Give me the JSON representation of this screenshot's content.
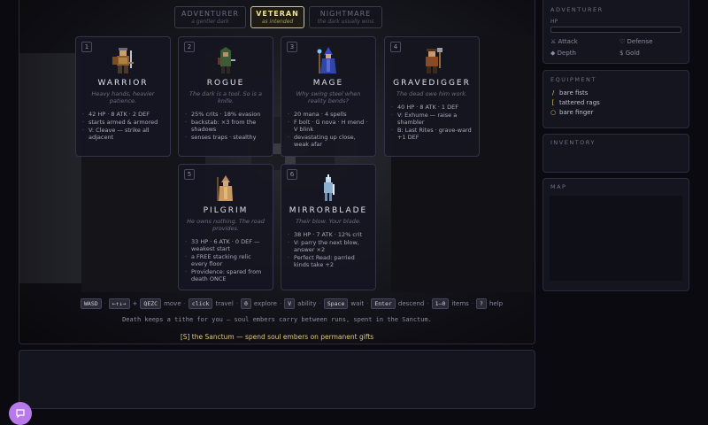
{
  "difficulty": [
    {
      "name": "ADVENTURER",
      "sub": "a gentler dark"
    },
    {
      "name": "VETERAN",
      "sub": "as intended"
    },
    {
      "name": "NIGHTMARE",
      "sub": "the dark usually wins"
    }
  ],
  "classes": [
    {
      "num": "1",
      "name": "WARRIOR",
      "tag": "Heavy hands, heavier patience.",
      "sprite": "warrior-sprite",
      "lines": [
        "42 HP · 8 ATK · 2 DEF",
        "starts armed & armored",
        "V: Cleave — strike all adjacent"
      ]
    },
    {
      "num": "2",
      "name": "ROGUE",
      "tag": "The dark is a tool. So is a knife.",
      "sprite": "rogue-sprite",
      "lines": [
        "25% crits · 18% evasion",
        "backstab: ×3 from the shadows",
        "senses traps · stealthy"
      ]
    },
    {
      "num": "3",
      "name": "MAGE",
      "tag": "Why swing steel when reality bends?",
      "sprite": "mage-sprite",
      "lines": [
        "20 mana · 4 spells",
        "F bolt · G nova · H mend · V blink",
        "devastating up close, weak afar"
      ]
    },
    {
      "num": "4",
      "name": "GRAVEDIGGER",
      "tag": "The dead owe him work.",
      "sprite": "gravedigger-sprite",
      "lines": [
        "40 HP · 8 ATK · 1 DEF",
        "V: Exhume — raise a shambler",
        "B: Last Rites · grave-ward +1 DEF"
      ]
    },
    {
      "num": "5",
      "name": "PILGRIM",
      "tag": "He owns nothing. The road provides.",
      "sprite": "pilgrim-sprite",
      "lines": [
        "33 HP · 6 ATK · 0 DEF — weakest start",
        "a FREE stacking relic every floor",
        "Providence: spared from death ONCE"
      ]
    },
    {
      "num": "6",
      "name": "MIRRORBLADE",
      "tag": "Their blow. Your blade.",
      "sprite": "mirrorblade-sprite",
      "lines": [
        "38 HP · 7 ATK · 12% crit",
        "V: parry the next blow, answer ×2",
        "Perfect Read: parried kinds take +2"
      ]
    }
  ],
  "hotkeys": {
    "k1": "WASD",
    "k2": "←↑↓→",
    "plus": "+",
    "k3": "QEZC",
    "t1": "move",
    "k4": "click",
    "t2": "travel",
    "k5": "0",
    "t3": "explore",
    "k6": "V",
    "t4": "ability",
    "k7": "Space",
    "t5": "wait",
    "k8": "Enter",
    "t6": "descend",
    "k9": "1–0",
    "t7": "items",
    "k10": "?",
    "t8": "help",
    "dot": "·"
  },
  "tithe": "Death keeps a tithe for you — soul embers carry between runs, spent in the Sanctum.",
  "sanctum": "[S] the Sanctum — spend soul embers on permanent gifts",
  "sidebar": {
    "adventurer_title": "ADVENTURER",
    "hp_label": "HP",
    "attack": "Attack",
    "defense": "Defense",
    "depth": "Depth",
    "gold": "Gold",
    "equipment_title": "EQUIPMENT",
    "equipment": [
      "bare fists",
      "tattered rags",
      "bare finger"
    ],
    "equipment_icons": [
      "/",
      "[",
      "○"
    ],
    "inventory_title": "INVENTORY",
    "map_title": "MAP"
  },
  "colors": {
    "accent": "#f0e090",
    "chat": "#b87ae8",
    "gold_text": "#e0c878"
  }
}
